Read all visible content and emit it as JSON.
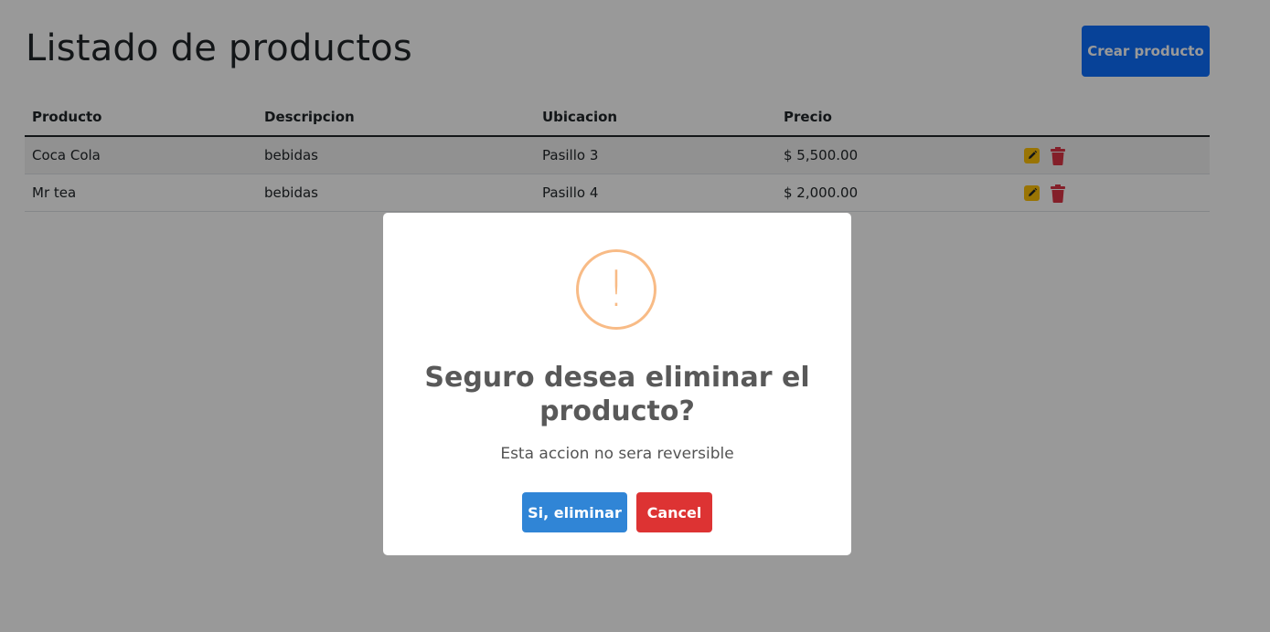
{
  "page": {
    "title": "Listado de productos",
    "create_button": "Crear producto"
  },
  "table": {
    "headers": [
      "Producto",
      "Descripcion",
      "Ubicacion",
      "Precio",
      ""
    ],
    "rows": [
      {
        "producto": "Coca Cola",
        "descripcion": "bebidas",
        "ubicacion": "Pasillo 3",
        "precio": "$ 5,500.00"
      },
      {
        "producto": "Mr tea",
        "descripcion": "bebidas",
        "ubicacion": "Pasillo 4",
        "precio": "$ 2,000.00"
      }
    ],
    "row_actions": {
      "edit_icon": "pencil-square-icon",
      "delete_icon": "trash-icon"
    }
  },
  "modal": {
    "icon": "!",
    "icon_name": "warning-icon",
    "title": "Seguro desea eliminar el producto?",
    "text": "Esta accion no sera reversible",
    "confirm_label": "Si, eliminar",
    "cancel_label": "Cancel"
  },
  "colors": {
    "primary": "#0d6efd",
    "edit": "#ffc107",
    "delete": "#dc3545",
    "confirm": "#3085d6",
    "cancel": "#dd3333",
    "warning": "#f8bb86",
    "backdrop": "rgba(0,0,0,0.4)"
  }
}
